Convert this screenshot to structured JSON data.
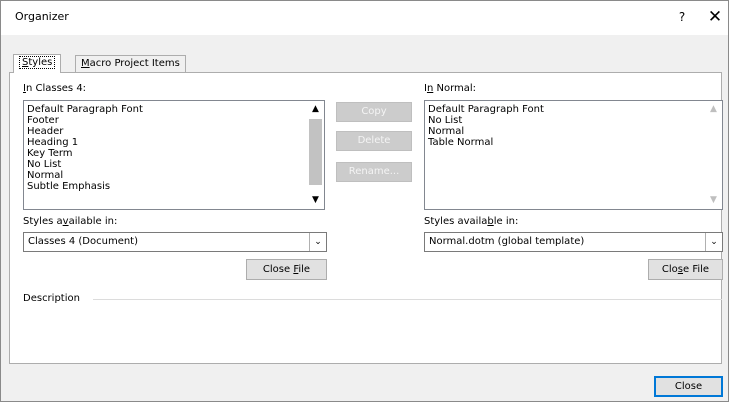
{
  "window": {
    "title": "Organizer",
    "help_glyph": "?",
    "close_glyph": "✕"
  },
  "tabs": {
    "styles": {
      "pre": "",
      "key": "S",
      "post": "tyles"
    },
    "macro": {
      "pre": "",
      "key": "M",
      "post": "acro Project Items"
    }
  },
  "left": {
    "list_label": {
      "pre": "",
      "key": "I",
      "post": "n Classes 4:"
    },
    "items": [
      "Default Paragraph Font",
      "Footer",
      "Header",
      "Heading 1",
      "Key Term",
      "No List",
      "Normal",
      "Subtle Emphasis"
    ],
    "available_label": {
      "pre": "Styles a",
      "key": "v",
      "post": "ailable in:"
    },
    "available_value": "Classes 4 (Document)",
    "close_file": {
      "pre": "Close ",
      "key": "F",
      "post": "ile"
    }
  },
  "middle": {
    "copy": "Copy",
    "delete": "Delete",
    "rename": "Rename..."
  },
  "right": {
    "list_label": {
      "pre": "I",
      "key": "n",
      "post": " Normal:"
    },
    "items": [
      "Default Paragraph Font",
      "No List",
      "Normal",
      "Table Normal"
    ],
    "available_label": {
      "pre": "Styles availa",
      "key": "b",
      "post": "le in:"
    },
    "available_value": "Normal.dotm (global template)",
    "close_file": {
      "pre": "Clo",
      "key": "s",
      "post": "e File"
    }
  },
  "description": {
    "label": "Description",
    "text": ""
  },
  "footer": {
    "close": "Close"
  },
  "icons": {
    "arrow_up": "▲",
    "arrow_down": "▼",
    "chevron_down": "⌄"
  }
}
